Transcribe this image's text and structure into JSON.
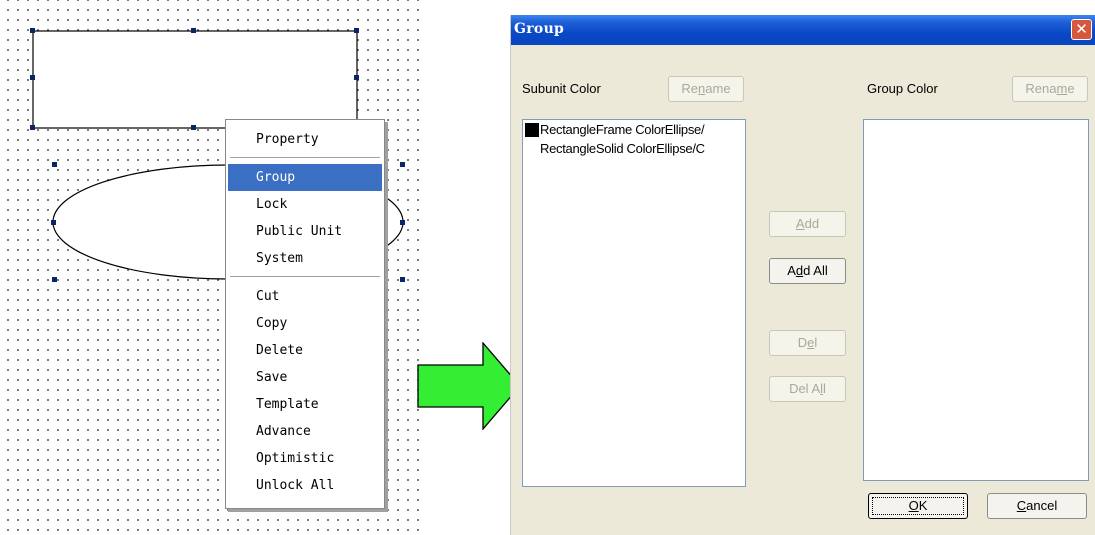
{
  "context_menu": {
    "group1": [
      "Property"
    ],
    "group2": [
      "Group",
      "Lock",
      "Public Unit",
      "System"
    ],
    "group3": [
      "Cut",
      "Copy",
      "Delete",
      "Save",
      "Template",
      "Advance",
      "Optimistic",
      "Unlock All"
    ],
    "selected": "Group"
  },
  "dialog": {
    "title": "Group",
    "close_glyph": "✕",
    "subunit_label": "Subunit Color",
    "group_label": "Group Color",
    "rename_left": {
      "pre": "Re",
      "u": "n",
      "post": "ame"
    },
    "rename_right": {
      "pre": "Rena",
      "u": "m",
      "post": "e"
    },
    "subunit_items": [
      {
        "text": "RectangleFrame ColorEllipse/",
        "swatch": "#000000"
      },
      {
        "text": "RectangleSolid ColorEllipse/C",
        "swatch": ""
      }
    ],
    "add": {
      "pre": "",
      "u": "A",
      "post": "dd"
    },
    "add_all": {
      "pre": "A",
      "u": "d",
      "post": "d All"
    },
    "del": {
      "pre": "D",
      "u": "e",
      "post": "l"
    },
    "del_all": {
      "pre": "Del A",
      "u": "l",
      "post": "l"
    },
    "ok": {
      "pre": "",
      "u": "O",
      "post": "K"
    },
    "cancel": {
      "pre": "",
      "u": "C",
      "post": "ancel"
    }
  },
  "colors": {
    "menu_highlight": "#3a6fc4",
    "titlebar": "#0a48c7",
    "arrow": "#33ee33",
    "dialog_bg": "#ece9d8"
  }
}
